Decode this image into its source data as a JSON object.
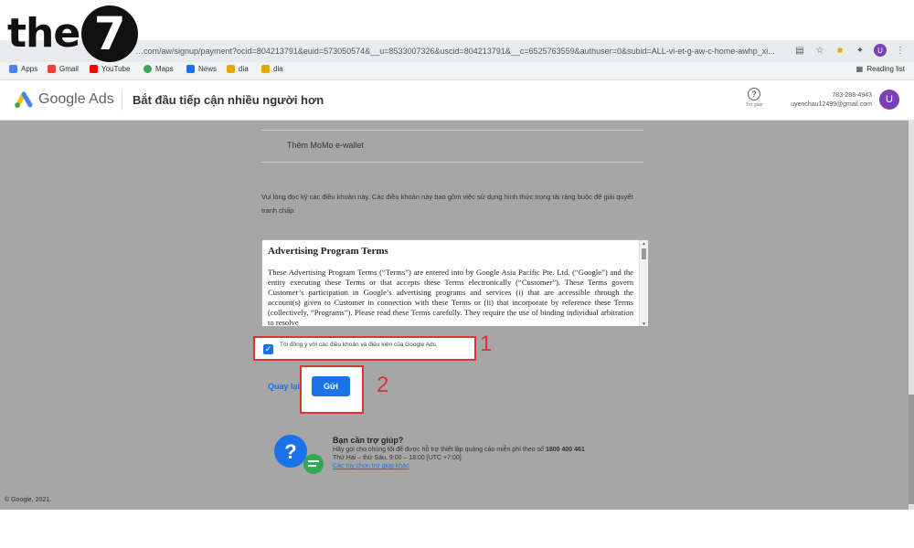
{
  "watermark": {
    "text": "the",
    "number": "7"
  },
  "browser": {
    "url": "…com/aw/signup/payment?ocid=804213791&euid=573050574&__u=8533007326&uscid=804213791&__c=6525763559&authuser=0&subid=ALL-vi-et-g-aw-c-home-awhp_xi...",
    "bookmarks": [
      "Apps",
      "Gmail",
      "YouTube",
      "Maps",
      "News",
      "dia",
      "dia"
    ],
    "reading_list": "Reading list",
    "avatar": "U"
  },
  "header": {
    "brand": "Google Ads",
    "title": "Bắt đầu tiếp cận nhiều người hơn",
    "help_label": "Trợ giúp",
    "phone": "783-288-4943",
    "email": "uyenchau12499@gmail.com",
    "avatar": "U"
  },
  "payment": {
    "option": "Thêm MoMo e-wallet"
  },
  "note": "Vui lòng đọc kỹ các điều khoản này. Các điều khoản này bao gồm việc sử dụng hình thức trọng tài ràng buộc để giải quyết tranh chấp.",
  "terms": {
    "title": "Advertising Program Terms",
    "body": "These Advertising Program Terms (“Terms”) are entered into by Google Asia Pacific Pte. Ltd. (“Google”) and the entity executing these Terms or that accepts these Terms electronically (“Customer”). These Terms govern Customer’s participation in Google’s advertising programs and services (i) that are accessible through the account(s) given to Customer in connection with these Terms or (ii) that incorporate by reference these Terms (collectively, “Programs”). Please read these Terms carefully. They require the use of binding individual arbitration to resolve"
  },
  "agree": {
    "label": "Tôi đồng ý với các điều khoản và điều kiện của Google Ads.",
    "checked": true,
    "marker": "1"
  },
  "actions": {
    "back": "Quay lại",
    "send": "Gửi",
    "marker": "2"
  },
  "help": {
    "title": "Bạn cần trợ giúp?",
    "desc": "Hãy gọi cho chúng tôi để được hỗ trợ thiết lập quảng cáo miễn phí theo số",
    "phone": "1800 400 461",
    "hours": "Thứ Hai – thứ Sáu, 9:00 – 18:00 [UTC +7:00]",
    "link": "Các tùy chọn trợ giúp khác"
  },
  "footer": "© Google, 2021.",
  "colors": {
    "accent": "#1a73e8",
    "highlight": "#e03232",
    "avatar": "#7b3fb8"
  }
}
